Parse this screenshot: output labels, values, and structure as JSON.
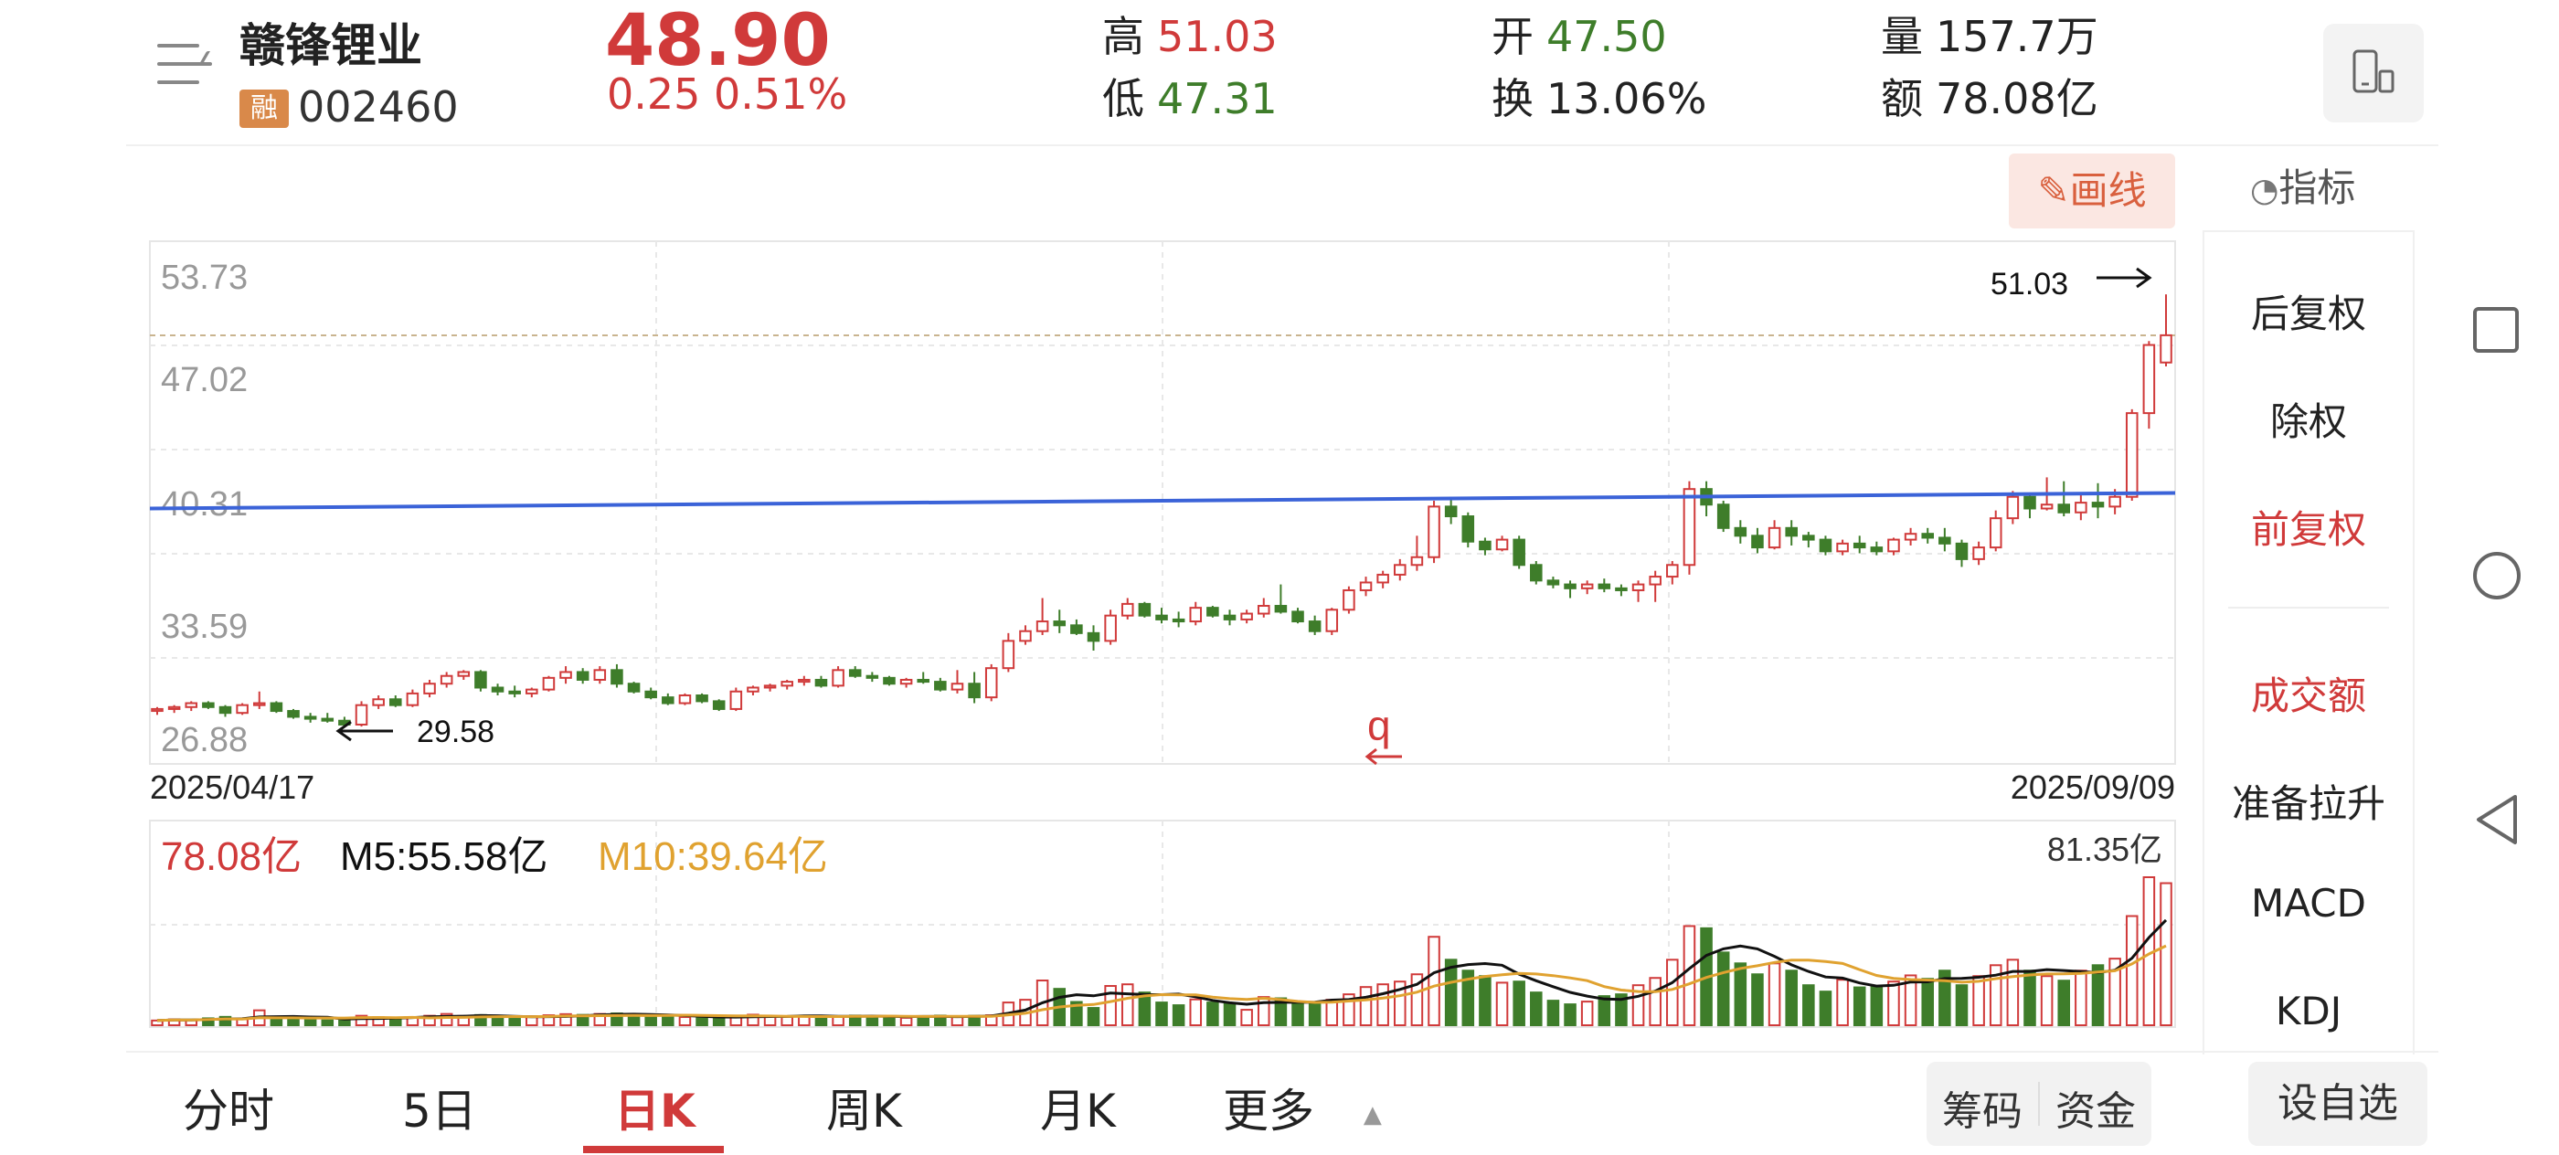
{
  "header": {
    "stock_name": "赣锋锂业",
    "margin_badge": "融",
    "stock_code": "002460",
    "price": "48.90",
    "change": "0.25  0.51%",
    "high_label": "高",
    "high_value": "51.03",
    "low_label": "低",
    "low_value": "47.31",
    "open_label": "开",
    "open_value": "47.50",
    "turnover_label": "换",
    "turnover_value": "13.06%",
    "volume_label": "量",
    "volume_value": "157.7万",
    "amount_label": "额",
    "amount_value": "78.08亿"
  },
  "toolbar": {
    "draw_label": "画线",
    "indicator_label": "指标"
  },
  "side_menu": [
    {
      "label": "后复权",
      "active": false
    },
    {
      "label": "除权",
      "active": false
    },
    {
      "label": "前复权",
      "active": true
    },
    {
      "label": "成交额",
      "active": true
    },
    {
      "label": "准备拉升",
      "active": false
    },
    {
      "label": "MACD",
      "active": false
    },
    {
      "label": "KDJ",
      "active": false
    }
  ],
  "price_panel": {
    "y_ticks": [
      "53.73",
      "47.02",
      "40.31",
      "33.59",
      "26.88"
    ],
    "start_date": "2025/04/17",
    "end_date": "2025/09/09",
    "max_annotation": "51.03",
    "min_annotation": "29.58",
    "marker_label": "q"
  },
  "volume_panel": {
    "current": "78.08亿",
    "m5": "M5:55.58亿",
    "m10": "M10:39.64亿",
    "max_label": "81.35亿"
  },
  "tabs": [
    "分时",
    "5日",
    "日K",
    "周K",
    "月K",
    "更多"
  ],
  "active_tab": "日K",
  "bottom_buttons": {
    "chips": "筹码",
    "funds": "资金",
    "watchlist": "设自选"
  },
  "colors": {
    "up": "#d03a3a",
    "down": "#3e7d2a",
    "trendline": "#3b63d8",
    "m5": "#111111",
    "m10": "#e0a230"
  },
  "chart_data": {
    "type": "candlestick",
    "y_range": [
      26.88,
      53.73
    ],
    "trendline": {
      "start": 40.0,
      "end": 40.8
    },
    "candles": [
      [
        29.6,
        29.8,
        29.4,
        29.7
      ],
      [
        29.7,
        29.9,
        29.5,
        29.8
      ],
      [
        29.8,
        30.1,
        29.6,
        30.0
      ],
      [
        30.0,
        30.1,
        29.7,
        29.8
      ],
      [
        29.8,
        29.9,
        29.3,
        29.5
      ],
      [
        29.5,
        30.0,
        29.4,
        29.9
      ],
      [
        29.9,
        30.6,
        29.7,
        30.0
      ],
      [
        30.0,
        30.1,
        29.5,
        29.6
      ],
      [
        29.6,
        29.7,
        29.2,
        29.3
      ],
      [
        29.3,
        29.5,
        29.0,
        29.2
      ],
      [
        29.2,
        29.5,
        29.0,
        29.1
      ],
      [
        29.1,
        29.3,
        28.8,
        28.9
      ],
      [
        28.9,
        30.1,
        28.8,
        29.9
      ],
      [
        29.9,
        30.4,
        29.7,
        30.2
      ],
      [
        30.2,
        30.4,
        29.8,
        29.9
      ],
      [
        29.9,
        30.7,
        29.8,
        30.5
      ],
      [
        30.5,
        31.2,
        30.3,
        31.0
      ],
      [
        31.0,
        31.6,
        30.8,
        31.4
      ],
      [
        31.4,
        31.7,
        31.2,
        31.6
      ],
      [
        31.6,
        31.7,
        30.6,
        30.8
      ],
      [
        30.8,
        31.0,
        30.4,
        30.6
      ],
      [
        30.6,
        30.9,
        30.3,
        30.5
      ],
      [
        30.5,
        30.8,
        30.3,
        30.7
      ],
      [
        30.7,
        31.4,
        30.6,
        31.3
      ],
      [
        31.3,
        31.9,
        31.0,
        31.6
      ],
      [
        31.6,
        31.8,
        31.0,
        31.2
      ],
      [
        31.2,
        31.9,
        31.0,
        31.7
      ],
      [
        31.7,
        32.0,
        30.8,
        31.0
      ],
      [
        31.0,
        31.1,
        30.5,
        30.6
      ],
      [
        30.6,
        30.8,
        30.2,
        30.3
      ],
      [
        30.3,
        30.5,
        29.9,
        30.0
      ],
      [
        30.0,
        30.5,
        29.9,
        30.4
      ],
      [
        30.4,
        30.5,
        30.0,
        30.1
      ],
      [
        30.1,
        30.2,
        29.6,
        29.7
      ],
      [
        29.7,
        30.8,
        29.6,
        30.6
      ],
      [
        30.6,
        30.9,
        30.4,
        30.8
      ],
      [
        30.8,
        31.0,
        30.6,
        30.9
      ],
      [
        30.9,
        31.2,
        30.7,
        31.1
      ],
      [
        31.1,
        31.4,
        30.9,
        31.2
      ],
      [
        31.2,
        31.4,
        30.8,
        30.9
      ],
      [
        30.9,
        31.9,
        30.8,
        31.7
      ],
      [
        31.7,
        31.9,
        31.3,
        31.4
      ],
      [
        31.4,
        31.6,
        31.1,
        31.3
      ],
      [
        31.3,
        31.4,
        30.9,
        31.0
      ],
      [
        31.0,
        31.3,
        30.8,
        31.2
      ],
      [
        31.2,
        31.6,
        31.0,
        31.1
      ],
      [
        31.1,
        31.3,
        30.6,
        30.7
      ],
      [
        30.7,
        31.7,
        30.5,
        31.0
      ],
      [
        31.0,
        31.6,
        30.0,
        30.3
      ],
      [
        30.3,
        32.0,
        30.1,
        31.8
      ],
      [
        31.8,
        33.6,
        31.6,
        33.2
      ],
      [
        33.2,
        34.0,
        33.0,
        33.7
      ],
      [
        33.7,
        35.4,
        33.5,
        34.2
      ],
      [
        34.2,
        34.8,
        33.6,
        34.0
      ],
      [
        34.0,
        34.3,
        33.5,
        33.6
      ],
      [
        33.6,
        34.0,
        32.7,
        33.2
      ],
      [
        33.2,
        34.8,
        33.0,
        34.5
      ],
      [
        34.5,
        35.4,
        34.3,
        35.1
      ],
      [
        35.1,
        35.2,
        34.4,
        34.5
      ],
      [
        34.5,
        34.9,
        34.1,
        34.3
      ],
      [
        34.3,
        34.7,
        33.9,
        34.2
      ],
      [
        34.2,
        35.2,
        34.0,
        34.9
      ],
      [
        34.9,
        35.0,
        34.4,
        34.5
      ],
      [
        34.5,
        34.8,
        34.0,
        34.3
      ],
      [
        34.3,
        34.8,
        34.1,
        34.6
      ],
      [
        34.6,
        35.4,
        34.4,
        35.0
      ],
      [
        35.0,
        36.1,
        34.6,
        34.7
      ],
      [
        34.7,
        34.9,
        34.1,
        34.2
      ],
      [
        34.2,
        34.5,
        33.5,
        33.7
      ],
      [
        33.7,
        34.9,
        33.5,
        34.8
      ],
      [
        34.8,
        36.0,
        34.6,
        35.8
      ],
      [
        35.8,
        36.5,
        35.5,
        36.2
      ],
      [
        36.2,
        36.8,
        35.9,
        36.6
      ],
      [
        36.6,
        37.4,
        36.3,
        37.1
      ],
      [
        37.1,
        38.6,
        36.8,
        37.5
      ],
      [
        37.5,
        40.4,
        37.2,
        40.1
      ],
      [
        40.1,
        40.6,
        39.2,
        39.6
      ],
      [
        39.6,
        39.8,
        38.0,
        38.3
      ],
      [
        38.3,
        38.5,
        37.6,
        37.9
      ],
      [
        37.9,
        38.6,
        37.8,
        38.4
      ],
      [
        38.4,
        38.6,
        36.9,
        37.1
      ],
      [
        37.1,
        37.3,
        36.1,
        36.3
      ],
      [
        36.3,
        36.5,
        35.9,
        36.1
      ],
      [
        36.1,
        36.3,
        35.4,
        35.9
      ],
      [
        35.9,
        36.3,
        35.6,
        36.1
      ],
      [
        36.1,
        36.4,
        35.7,
        35.9
      ],
      [
        35.9,
        36.1,
        35.5,
        35.8
      ],
      [
        35.8,
        36.3,
        35.2,
        36.1
      ],
      [
        36.1,
        36.8,
        35.2,
        36.5
      ],
      [
        36.5,
        37.3,
        36.1,
        37.1
      ],
      [
        37.1,
        41.4,
        36.6,
        41.0
      ],
      [
        41.0,
        41.4,
        39.6,
        40.2
      ],
      [
        40.2,
        40.4,
        38.8,
        39.0
      ],
      [
        39.0,
        39.4,
        38.2,
        38.6
      ],
      [
        38.6,
        39.0,
        37.7,
        38.0
      ],
      [
        38.0,
        39.4,
        37.9,
        39.0
      ],
      [
        39.0,
        39.4,
        38.1,
        38.6
      ],
      [
        38.6,
        38.8,
        38.0,
        38.4
      ],
      [
        38.4,
        38.6,
        37.6,
        37.8
      ],
      [
        37.8,
        38.4,
        37.6,
        38.2
      ],
      [
        38.2,
        38.6,
        37.7,
        38.0
      ],
      [
        38.0,
        38.3,
        37.6,
        37.8
      ],
      [
        37.8,
        38.5,
        37.6,
        38.4
      ],
      [
        38.4,
        39.0,
        38.1,
        38.7
      ],
      [
        38.7,
        39.0,
        38.2,
        38.5
      ],
      [
        38.5,
        39.0,
        37.8,
        38.2
      ],
      [
        38.2,
        38.4,
        37.0,
        37.4
      ],
      [
        37.4,
        38.3,
        37.1,
        38.0
      ],
      [
        38.0,
        39.9,
        37.8,
        39.5
      ],
      [
        39.5,
        40.9,
        39.2,
        40.6
      ],
      [
        40.6,
        40.8,
        39.5,
        40.0
      ],
      [
        40.0,
        41.6,
        39.9,
        40.2
      ],
      [
        40.2,
        41.4,
        39.6,
        39.8
      ],
      [
        39.8,
        40.7,
        39.4,
        40.3
      ],
      [
        40.3,
        41.3,
        39.5,
        40.1
      ],
      [
        40.1,
        41.0,
        39.7,
        40.6
      ],
      [
        40.6,
        45.1,
        40.4,
        44.9
      ],
      [
        44.9,
        48.6,
        44.1,
        48.4
      ],
      [
        47.5,
        51.0,
        47.3,
        48.9
      ]
    ],
    "volume_billion": [
      2.6,
      3.2,
      3.0,
      3.8,
      4.6,
      3.3,
      8.2,
      3.8,
      4.3,
      3.0,
      2.7,
      3.2,
      5.2,
      4.4,
      3.8,
      4.5,
      5.2,
      6.2,
      5.1,
      5.6,
      4.0,
      3.5,
      5.0,
      5.5,
      6.1,
      5.7,
      6.2,
      6.5,
      5.8,
      5.1,
      4.8,
      4.5,
      4.2,
      3.9,
      4.9,
      5.8,
      5.0,
      4.6,
      5.2,
      5.0,
      4.6,
      5.3,
      5.0,
      4.7,
      4.1,
      4.9,
      5.3,
      4.5,
      5.2,
      5.5,
      12.5,
      14.0,
      24.6,
      20.0,
      12.8,
      9.5,
      21.6,
      22.5,
      18.0,
      12.5,
      11.0,
      14.2,
      12.5,
      11.6,
      8.5,
      15.5,
      14.8,
      12.6,
      12.2,
      14.0,
      17.0,
      21.0,
      22.5,
      24.0,
      28.0,
      48.6,
      36.0,
      30.0,
      27.0,
      23.4,
      24.0,
      18.0,
      13.5,
      11.5,
      13.0,
      16.0,
      17.0,
      22.0,
      26.0,
      36.0,
      54.5,
      53.3,
      40.0,
      34.0,
      28.0,
      34.0,
      30.0,
      22.0,
      18.5,
      25.0,
      20.8,
      21.5,
      24.0,
      27.4,
      25.5,
      30.0,
      22.0,
      27.0,
      33.0,
      36.0,
      30.0,
      27.0,
      24.5,
      30.0,
      33.0,
      36.6,
      60.0,
      81.35,
      78.08
    ]
  }
}
